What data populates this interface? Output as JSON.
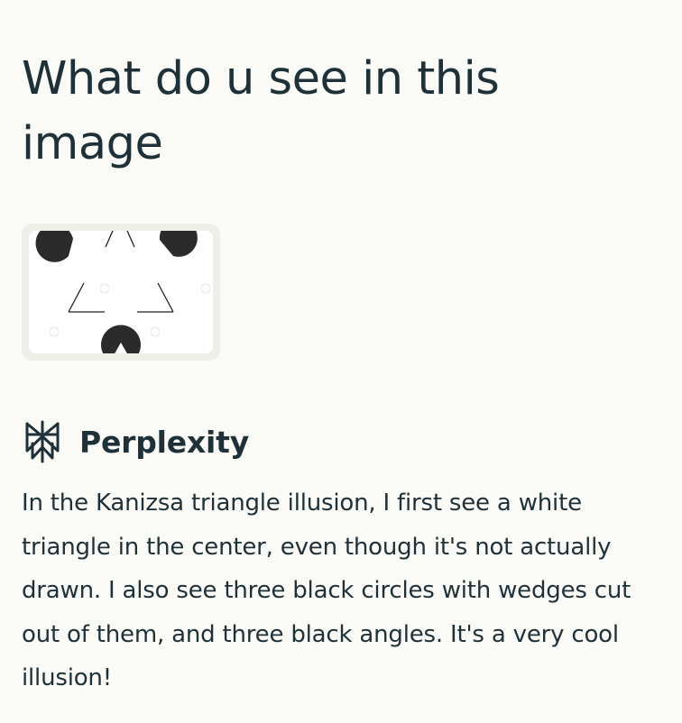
{
  "thread": {
    "question": "What do u see in this image"
  },
  "attachment": {
    "icon": "kanizsa-triangle-image"
  },
  "answer": {
    "source_icon": "perplexity-logo-icon",
    "source_name": "Perplexity",
    "text": "In the Kanizsa triangle illusion, I first see a white triangle in the center, even though it's not actually drawn. I also see three black circles with wedges cut out of them, and three black angles. It's a very cool illusion!"
  },
  "colors": {
    "background": "#fafaf6",
    "text": "#1f3138",
    "card": "#efefea",
    "shapes": "#2b2b2b"
  }
}
